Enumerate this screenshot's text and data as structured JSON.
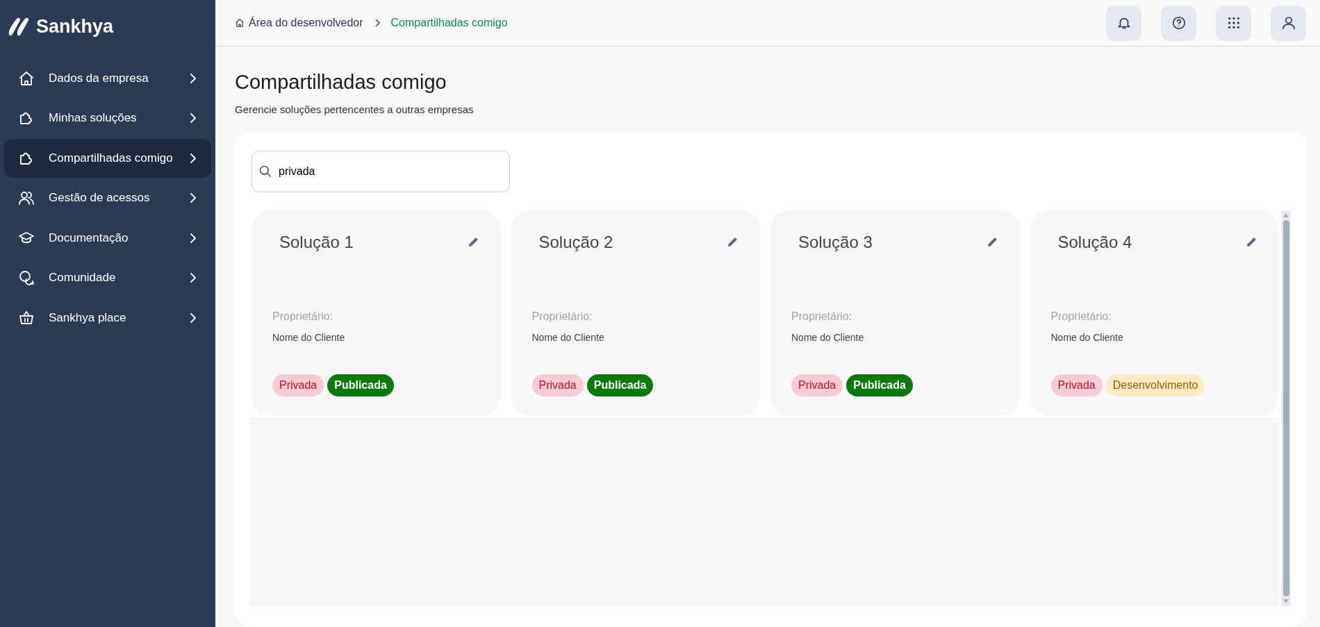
{
  "brand": {
    "name": "Sankhya"
  },
  "sidebar": {
    "items": [
      {
        "label": "Dados da empresa",
        "selected": false
      },
      {
        "label": "Minhas soluções",
        "selected": false
      },
      {
        "label": "Compartilhadas comigo",
        "selected": true
      },
      {
        "label": "Gestão de acessos",
        "selected": false
      },
      {
        "label": "Documentação",
        "selected": false
      },
      {
        "label": "Comunidade",
        "selected": false
      },
      {
        "label": "Sankhya place",
        "selected": false
      }
    ]
  },
  "breadcrumb": [
    {
      "label": "Área do desenvolvedor",
      "current": false
    },
    {
      "label": "Compartilhadas comigo",
      "current": true
    }
  ],
  "page": {
    "title": "Compartilhadas comigo",
    "subtitle": "Gerencie soluções pertencentes a outras empresas"
  },
  "search": {
    "value": "privada"
  },
  "cards": [
    {
      "title": "Solução 1",
      "owner_label": "Proprietário:",
      "owner": "Nome do Cliente",
      "tags": [
        {
          "label": "Privada",
          "kind": "private"
        },
        {
          "label": "Publicada",
          "kind": "published"
        }
      ]
    },
    {
      "title": "Solução 2",
      "owner_label": "Proprietário:",
      "owner": "Nome do Cliente",
      "tags": [
        {
          "label": "Privada",
          "kind": "private"
        },
        {
          "label": "Publicada",
          "kind": "published"
        }
      ]
    },
    {
      "title": "Solução 3",
      "owner_label": "Proprietário:",
      "owner": "Nome do Cliente",
      "tags": [
        {
          "label": "Privada",
          "kind": "private"
        },
        {
          "label": "Publicada",
          "kind": "published"
        }
      ]
    },
    {
      "title": "Solução 4",
      "owner_label": "Proprietário:",
      "owner": "Nome do Cliente",
      "tags": [
        {
          "label": "Privada",
          "kind": "private"
        },
        {
          "label": "Desenvolvimento",
          "kind": "development"
        }
      ]
    }
  ]
}
